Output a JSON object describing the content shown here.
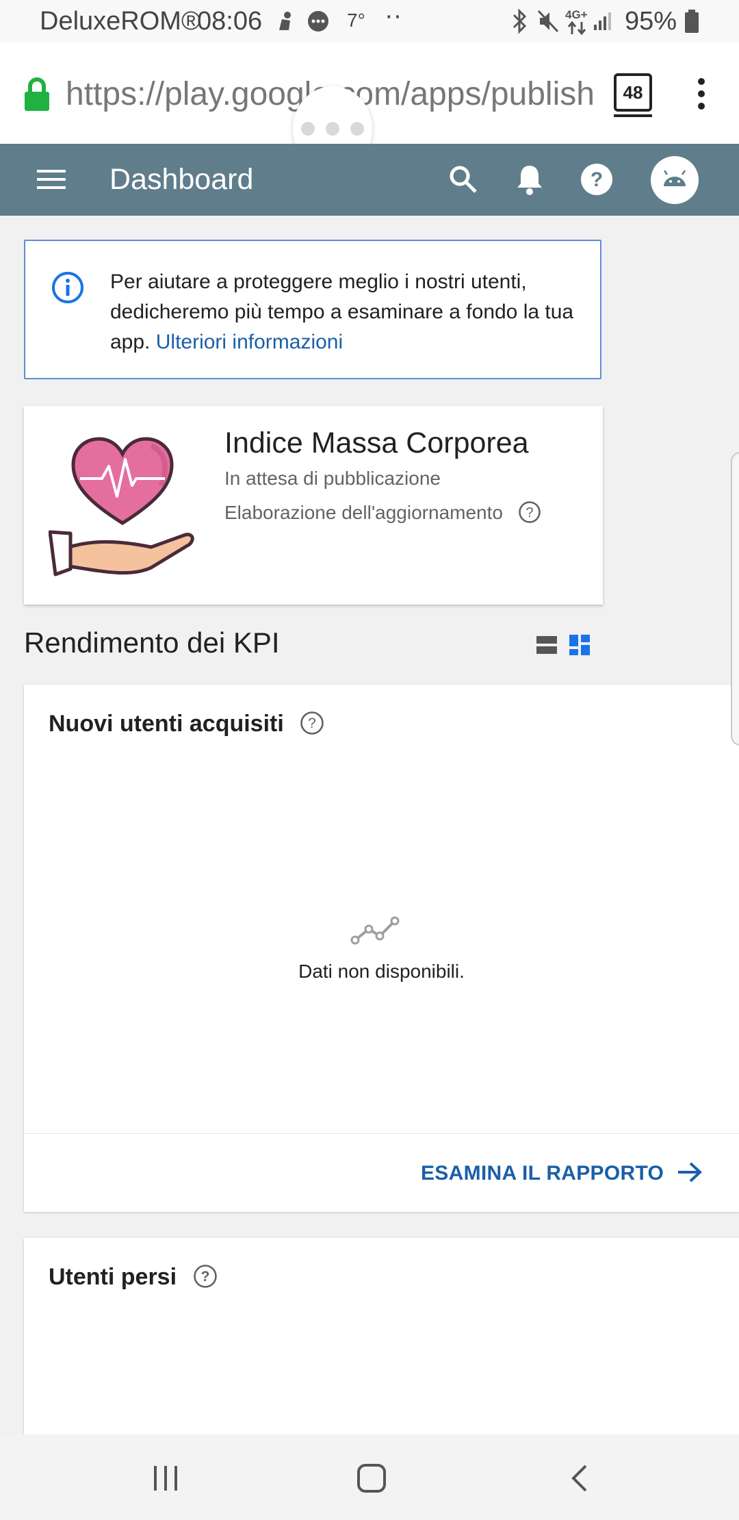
{
  "status_bar": {
    "carrier": "DeluxeROM®",
    "time": "08:06",
    "temperature": "7°",
    "network": "4G+",
    "battery": "95%"
  },
  "browser": {
    "url": "https://play.google.com/apps/publish",
    "tab_count": "48"
  },
  "app_bar": {
    "title": "Dashboard"
  },
  "banner": {
    "text": "Per aiutare a proteggere meglio i nostri utenti, dedicheremo più tempo a esaminare a fondo la tua app.",
    "link": "Ulteriori informazioni"
  },
  "app_card": {
    "name": "Indice Massa Corporea",
    "status": "In attesa di pubblicazione",
    "processing": "Elaborazione dell'aggiornamento"
  },
  "kpi": {
    "section_title": "Rendimento dei KPI",
    "cards": [
      {
        "title": "Nuovi utenti acquisiti",
        "empty_text": "Dati non disponibili.",
        "action": "ESAMINA IL RAPPORTO"
      },
      {
        "title": "Utenti persi"
      }
    ]
  },
  "colors": {
    "app_bar": "#607d8b",
    "link": "#1a5fa8",
    "banner_border": "#5b8dd6",
    "secure_lock": "#1fb141",
    "heart": "#e46f9e"
  }
}
